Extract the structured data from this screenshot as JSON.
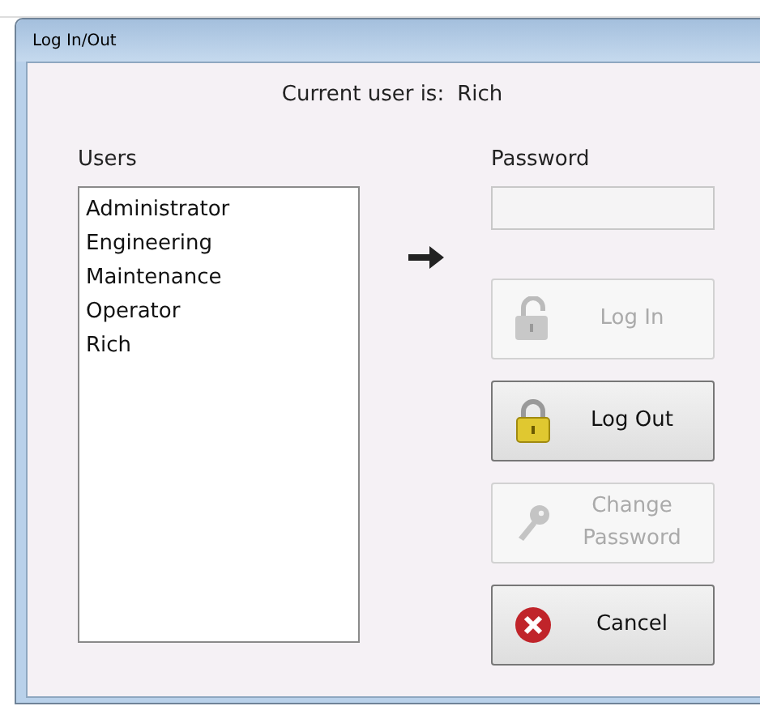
{
  "window": {
    "title": "Log In/Out"
  },
  "current_user": {
    "label": "Current user is:",
    "value": "Rich"
  },
  "users": {
    "label": "Users",
    "items": [
      {
        "name": "Administrator",
        "selected": false
      },
      {
        "name": "Engineering",
        "selected": false
      },
      {
        "name": "Maintenance",
        "selected": false
      },
      {
        "name": "Operator",
        "selected": false
      },
      {
        "name": "Rich",
        "selected": false
      }
    ]
  },
  "password": {
    "label": "Password",
    "disabled": true
  },
  "buttons": [
    {
      "label": "Log In",
      "kind": "unlock",
      "disabled": true
    },
    {
      "label": "Log Out",
      "kind": "lock",
      "disabled": false
    },
    {
      "label": "Change Password",
      "kind": "key",
      "disabled": true
    },
    {
      "label": "Cancel",
      "kind": "cancel",
      "disabled": false
    }
  ]
}
